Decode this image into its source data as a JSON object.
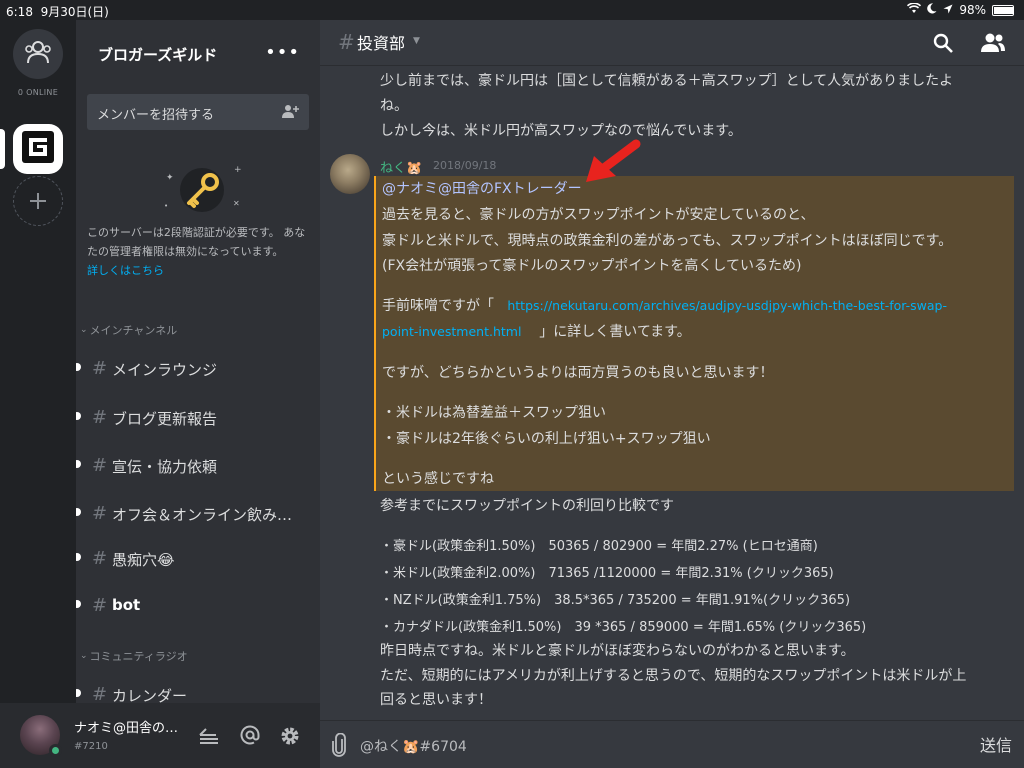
{
  "status_bar": {
    "time": "6:18",
    "date": "9月30日(日)",
    "battery": "98%",
    "battery_level": 0.98
  },
  "rail": {
    "online_label": "0 ONLINE"
  },
  "sidebar": {
    "guild_name": "ブロガーズギルド",
    "more": "•••",
    "invite_label": "メンバーを招待する",
    "notice_text": "このサーバーは2段階認証が必要です。 あなたの管理者権限は無効になっています。",
    "notice_link": "詳しくはこちら",
    "categories": [
      "メインチャンネル",
      "コミュニティラジオ"
    ],
    "channels": [
      {
        "name": "メインラウンジ"
      },
      {
        "name": "ブログ更新報告"
      },
      {
        "name": "宣伝・協力依頼"
      },
      {
        "name": "オフ会＆オンライン飲み…"
      },
      {
        "name": "愚痴穴😂"
      },
      {
        "name": "bot"
      },
      {
        "name": "カレンダー"
      }
    ]
  },
  "user_panel": {
    "name": "ナオミ@田舎の…",
    "tag": "#7210"
  },
  "chat": {
    "channel": "投資部",
    "prev_lines": [
      "少し前までは、豪ドル円は［国として信頼がある＋高スワップ］として人気がありましたよ",
      "ね。",
      "しかし今は、米ドル円が高スワップなので悩んでいます。"
    ],
    "author": "ねく🐹",
    "date": "2018/09/18",
    "mention": "@ナオミ@田舎のFXトレーダー",
    "mb_lines": [
      "過去を見ると、豪ドルの方がスワップポイントが安定しているのと、",
      "豪ドルと米ドルで、現時点の政策金利の差があっても、スワップポイントはほぼ同じです。",
      "(FX会社が頑張って豪ドルのスワップポイントを高くしているため)"
    ],
    "link_prefix": "手前味噌ですが「",
    "link_url_1": "https://nekutaru.com/archives/audjpy-usdjpy-which-the-best-for-swap-",
    "link_url_2": "point-investment.html",
    "link_suffix": "」に詳しく書いてます。",
    "mb_line_both": "ですが、どちらかというよりは両方買うのも良いと思います！",
    "mb_bullet_1": "・米ドルは為替差益＋スワップ狙い",
    "mb_bullet_2": "・豪ドルは2年後ぐらいの利上げ狙い+スワップ狙い",
    "mb_closing": "という感じですね",
    "after_lines": [
      "参考までにスワップポイントの利回り比較です",
      "",
      "・豪ドル(政策金利1.50%)　50365 / 802900 = 年間2.27% (ヒロセ通商)",
      "・米ドル(政策金利2.00%)　71365 /1120000 = 年間2.31% (クリック365)",
      "・NZドル(政策金利1.75%)　38.5*365 / 735200 = 年間1.91%(クリック365)",
      "・カナダドル(政策金利1.50%)　39 *365 / 859000 = 年間1.65% (クリック365)",
      "昨日時点ですね。米ドルと豪ドルがほぼ変わらないのがわかると思います。",
      "ただ、短期的にはアメリカが利上げすると思うので、短期的なスワップポイントは米ドルが上",
      "回ると思います！"
    ]
  },
  "composer": {
    "placeholder": "@ねく🐹#6704",
    "send_label": "送信"
  },
  "colors": {
    "accent_online": "#43b581",
    "mention_bg": "#5a4a30",
    "mention_bar": "#faa61a",
    "link": "#00b0f4",
    "arrow": "#e8231e"
  }
}
